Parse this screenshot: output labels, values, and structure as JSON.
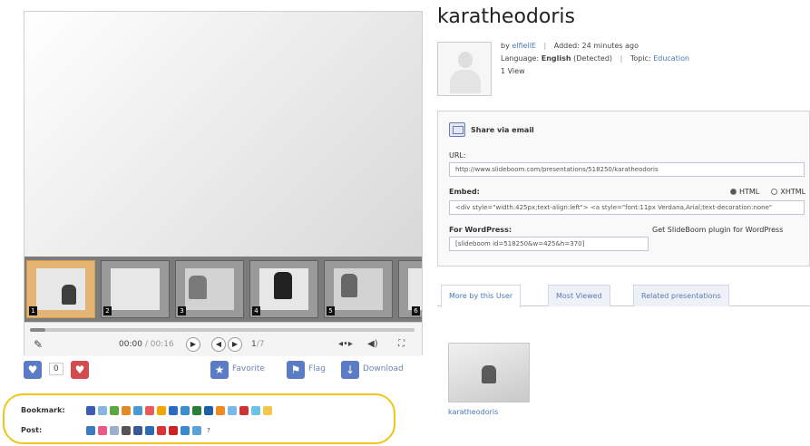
{
  "presentation": {
    "title": "karatheodoris",
    "byline_prefix": "by",
    "author": "elfiellE",
    "added": "Added: 24 minutes ago",
    "language_prefix": "Language:",
    "language": "English",
    "language_suffix": "(Detected)",
    "topic_prefix": "Topic:",
    "topic": "Education",
    "views": "1 View"
  },
  "player": {
    "thumbnail_numbers": [
      "1",
      "2",
      "3",
      "4",
      "5",
      "6"
    ],
    "time_current": "00:00",
    "time_total": "00:16",
    "slide_position": "1",
    "slide_total": "7",
    "progress_fraction": 0.04
  },
  "actions": {
    "favorite_count": "0",
    "favorite_label": "Favorite",
    "flag_label": "Flag",
    "download_label": "Download"
  },
  "share_bar": {
    "bookmark_label": "Bookmark:",
    "post_label": "Post:"
  },
  "embed": {
    "share_email_label": "Share via email",
    "url_label": "URL:",
    "url_value": "http://www.slideboom.com/presentations/518250/karatheodoris",
    "embed_label": "Embed:",
    "html_option": "HTML",
    "xhtml_option": "XHTML",
    "embed_value": "<div style=\"width:425px;text-align:left\"> <a style=\"font:11px Verdana,Arial;text-decoration:none\"",
    "wordpress_label": "For WordPress:",
    "wordpress_link": "Get SlideBoom plugin for WordPress",
    "wordpress_value": "[slideboom id=518250&w=425&h=370]"
  },
  "tabs": [
    {
      "label": "More by this User"
    },
    {
      "label": "Most Viewed"
    },
    {
      "label": "Related presentations"
    }
  ],
  "related": {
    "caption": "karatheodoris"
  },
  "colors": {
    "share_outline": "#f0c419",
    "link": "#4a78b5",
    "thumb_active": "#e3b474"
  }
}
